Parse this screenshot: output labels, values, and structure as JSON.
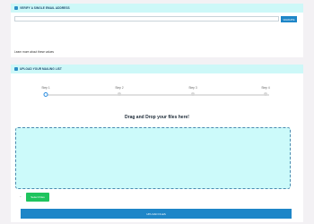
{
  "verify_section": {
    "title": "VERIFY A SINGLE EMAIL ADDRESS",
    "input_value": "",
    "input_placeholder": "",
    "validate_label": "VALIDATE",
    "learn_more": "Learn more about these values"
  },
  "upload_section": {
    "title": "UPLOAD YOUR MAILING LIST",
    "steps": [
      {
        "label": "Step 1",
        "active": true
      },
      {
        "label": "Step 2",
        "active": false
      },
      {
        "label": "Step 3",
        "active": false
      },
      {
        "label": "Step 4",
        "active": false
      }
    ],
    "drop_title": "Drag and Drop your files here!",
    "arrow": "←",
    "select_files_label": "Select Files",
    "upload_label": "UPLOAD FILES"
  },
  "colors": {
    "header_bg": "#cdf8f8",
    "accent_blue": "#1e86c8",
    "accent_green": "#1fc45e",
    "dropzone_bg": "#ccfafa"
  }
}
